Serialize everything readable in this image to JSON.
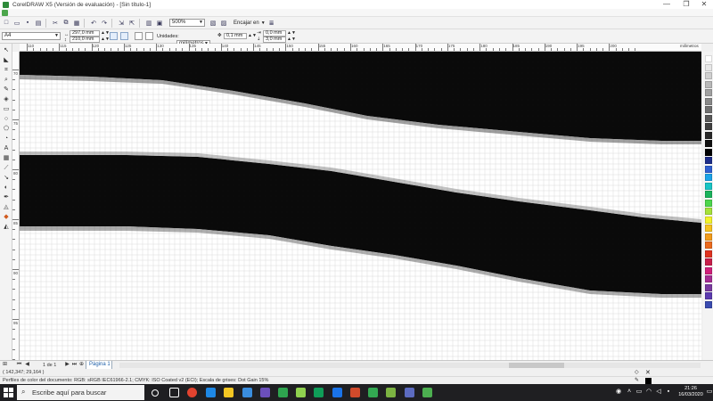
{
  "window": {
    "title": "CorelDRAW X5 (Versión de evaluación) - [Sin título-1]",
    "controls": {
      "minimize": "—",
      "restore": "❐",
      "close": "✕"
    }
  },
  "toolbar": {
    "zoom_value": "500%",
    "snap_label": "Encajar en"
  },
  "property_bar": {
    "paper_size": "A4",
    "width": "297,0 mm",
    "height": "210,0 mm",
    "units_label": "Unidades:",
    "units_value": "milímetros",
    "nudge": "0,1 mm",
    "dup_x": "0,0 mm",
    "dup_y": "3,0 mm"
  },
  "ruler": {
    "unit": "milímetros",
    "h_labels": [
      "110",
      "115",
      "120",
      "125",
      "130",
      "135",
      "140",
      "145",
      "150",
      "155",
      "160",
      "165",
      "170",
      "175",
      "180",
      "185",
      "190",
      "195",
      "200"
    ],
    "v_labels": [
      "70",
      "75",
      "80",
      "85",
      "90",
      "95"
    ]
  },
  "page_nav": {
    "count": "1 de 1",
    "tab": "Página 1"
  },
  "status": {
    "coords": "( 142,347; 29,164 )",
    "color_profile": "Perfiles de color del documento: RGB: sRGB IEC61966-2.1; CMYK: ISO Coated v2 (ECI); Escala de grises: Dot Gain 15%"
  },
  "taskbar": {
    "search_placeholder": "Escribe aquí para buscar",
    "time": "21:26",
    "date": "16/03/2020"
  },
  "palette": [
    "#ffffff",
    "#e8e8e8",
    "#d0d0d0",
    "#b8b8b8",
    "#a0a0a0",
    "#888888",
    "#707070",
    "#585858",
    "#404040",
    "#282828",
    "#101010",
    "#000000",
    "#1d2d8a",
    "#2f5fd0",
    "#1aa3e8",
    "#17c5c5",
    "#19b35b",
    "#4cd64c",
    "#a6e23a",
    "#f3f32a",
    "#f6c21f",
    "#f39c1b",
    "#ec6a1d",
    "#e0321f",
    "#c81e4a",
    "#d0207a",
    "#a62d93",
    "#7a3aa0",
    "#5b3ab0",
    "#3a4bb0"
  ]
}
